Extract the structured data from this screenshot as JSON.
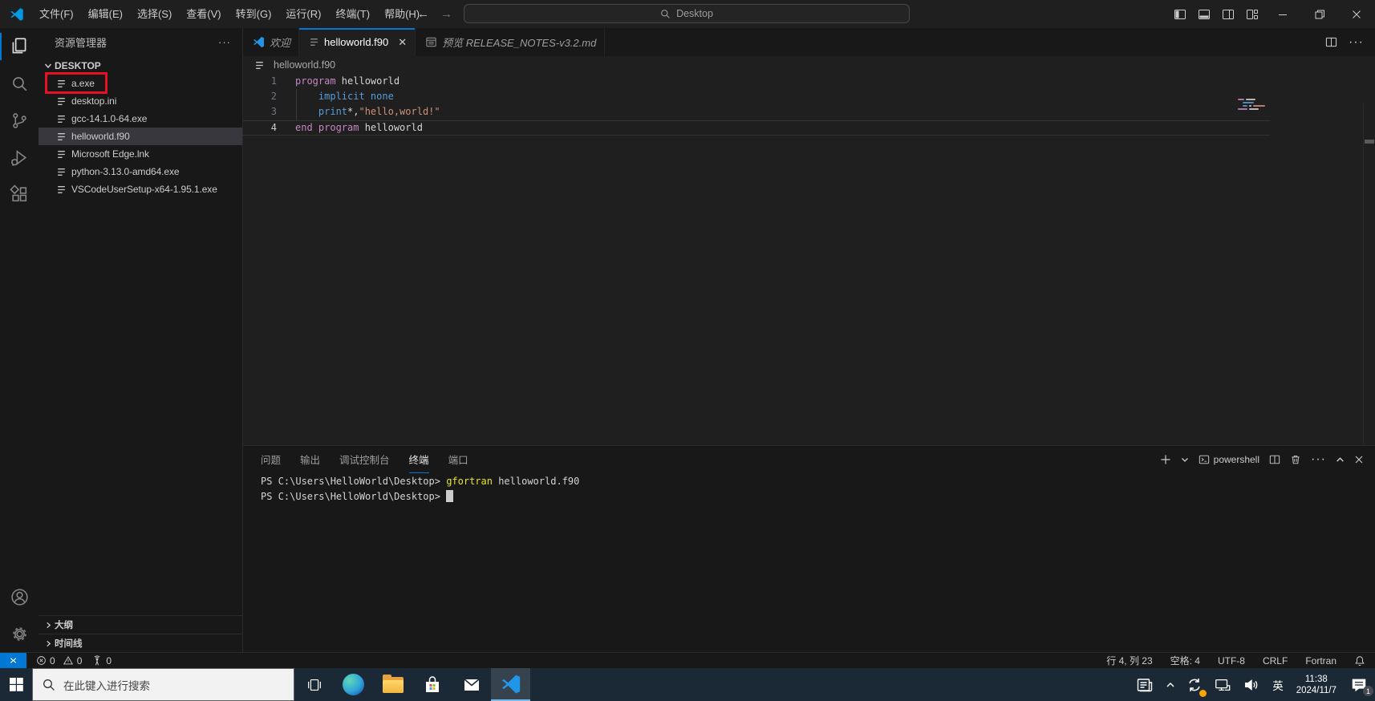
{
  "colors": {
    "accent": "#0078d4",
    "annotation": "#e81123",
    "kwc": "#c586c0",
    "kw": "#569cd6",
    "str": "#ce9178",
    "pln": "#d4d4d4",
    "cmd": "#e5e510",
    "termfg": "#cccccc"
  },
  "titlebar": {
    "menus": [
      {
        "label": "文件(F)"
      },
      {
        "label": "编辑(E)"
      },
      {
        "label": "选择(S)"
      },
      {
        "label": "查看(V)"
      },
      {
        "label": "转到(G)"
      },
      {
        "label": "运行(R)"
      },
      {
        "label": "终端(T)"
      },
      {
        "label": "帮助(H)"
      }
    ],
    "search_label": "Desktop"
  },
  "activity_bar": {
    "top": [
      {
        "icon": "explorer-icon",
        "active": true
      },
      {
        "icon": "search-icon"
      },
      {
        "icon": "source-control-icon"
      },
      {
        "icon": "run-debug-icon"
      },
      {
        "icon": "extensions-icon"
      }
    ],
    "bottom": [
      {
        "icon": "account-icon"
      },
      {
        "icon": "settings-gear-icon"
      }
    ]
  },
  "sidebar": {
    "title": "资源管理器",
    "section_label": "DESKTOP",
    "files": [
      {
        "name": "a.exe",
        "annotated": true
      },
      {
        "name": "desktop.ini"
      },
      {
        "name": "gcc-14.1.0-64.exe"
      },
      {
        "name": "helloworld.f90",
        "selected": true
      },
      {
        "name": "Microsoft Edge.lnk"
      },
      {
        "name": "python-3.13.0-amd64.exe"
      },
      {
        "name": "VSCodeUserSetup-x64-1.95.1.exe"
      }
    ],
    "bottom_sections": [
      {
        "label": "大纲"
      },
      {
        "label": "时间线"
      }
    ]
  },
  "tabs": [
    {
      "label": "欢迎",
      "icon": "vscode-logo",
      "italic": true
    },
    {
      "label": "helloworld.f90",
      "icon": "file-icon",
      "active": true,
      "closable": true
    },
    {
      "label": "预览 RELEASE_NOTES-v3.2.md",
      "icon": "preview-icon",
      "italic": true
    }
  ],
  "breadcrumb": "helloworld.f90",
  "editor": {
    "lines": [
      {
        "num": "1",
        "tokens": [
          {
            "t": "program",
            "c": "kwc"
          },
          {
            "t": " helloworld",
            "c": "pln"
          }
        ]
      },
      {
        "num": "2",
        "tokens": [
          {
            "t": "    ",
            "c": "pln"
          },
          {
            "t": "implicit none",
            "c": "kw"
          }
        ]
      },
      {
        "num": "3",
        "tokens": [
          {
            "t": "    ",
            "c": "pln"
          },
          {
            "t": "print",
            "c": "kw"
          },
          {
            "t": "*,",
            "c": "pln"
          },
          {
            "t": "\"hello,world!\"",
            "c": "str"
          }
        ]
      },
      {
        "num": "4",
        "tokens": [
          {
            "t": "end program",
            "c": "kwc"
          },
          {
            "t": " helloworld",
            "c": "pln"
          }
        ],
        "current": true
      }
    ]
  },
  "panel": {
    "tabs": [
      {
        "label": "问题"
      },
      {
        "label": "输出"
      },
      {
        "label": "调试控制台"
      },
      {
        "label": "终端",
        "active": true
      },
      {
        "label": "端口"
      }
    ],
    "shell_label": "powershell",
    "terminal_lines": [
      {
        "tokens": [
          {
            "t": "PS C:\\Users\\HelloWorld\\Desktop> ",
            "c": "pln"
          },
          {
            "t": "gfortran",
            "c": "cmd"
          },
          {
            "t": " helloworld.f90",
            "c": "pln"
          }
        ]
      },
      {
        "tokens": [
          {
            "t": "PS C:\\Users\\HelloWorld\\Desktop> ",
            "c": "pln"
          }
        ],
        "cursor": true
      }
    ]
  },
  "status_bar": {
    "errors": "0",
    "warnings": "0",
    "ports": "0",
    "line_col": "行 4, 列 23",
    "spaces": "空格: 4",
    "encoding": "UTF-8",
    "eol": "CRLF",
    "language": "Fortran"
  },
  "taskbar": {
    "search_placeholder": "在此键入进行搜索",
    "input_lang": "英",
    "time": "11:38",
    "date": "2024/11/7",
    "notification_count": "1"
  }
}
